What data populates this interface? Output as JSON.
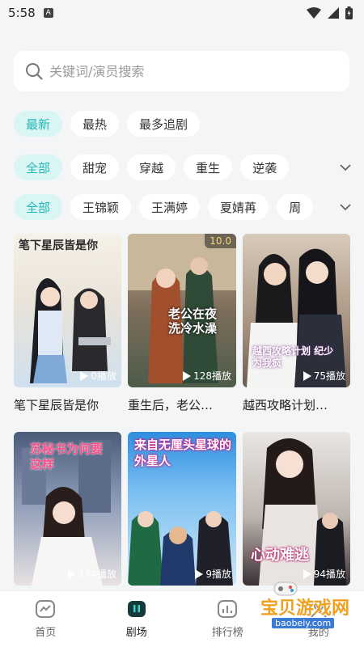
{
  "status": {
    "time": "5:58",
    "badge": "A"
  },
  "search": {
    "placeholder": "关键词/演员搜索"
  },
  "sort_tabs": [
    "最新",
    "最热",
    "最多追剧"
  ],
  "genre_tabs": [
    "全部",
    "甜宠",
    "穿越",
    "重生",
    "逆袭"
  ],
  "actor_tabs": [
    "全部",
    "王锦颖",
    "王满婷",
    "夏婧苒",
    "周"
  ],
  "dramas": [
    {
      "title": "笔下星辰皆是你",
      "plays": "0播放",
      "poster_text": "笔下星辰皆是你"
    },
    {
      "title": "重生后，老公…",
      "plays": "128播放",
      "score": "10.0",
      "poster_text": "老公在夜洗冷水澡"
    },
    {
      "title": "越西攻略计划…",
      "plays": "75播放",
      "poster_text": "越西攻略计划 纪少为我疯"
    },
    {
      "title": "",
      "plays": "174播放",
      "poster_text": "苏秘书为何要这样"
    },
    {
      "title": "",
      "plays": "9播放",
      "poster_text": "来自无厘头星球的外星人"
    },
    {
      "title": "",
      "plays": "94播放",
      "poster_text": "心动难逃"
    }
  ],
  "tabbar": [
    {
      "label": "首页",
      "icon": "home-icon"
    },
    {
      "label": "剧场",
      "icon": "theater-icon"
    },
    {
      "label": "排行榜",
      "icon": "rank-icon"
    },
    {
      "label": "我的",
      "icon": "profile-icon"
    }
  ],
  "watermark": {
    "text": "宝贝游戏网",
    "url": "baobeiy.com"
  },
  "colors": {
    "accent": "#1fb8b4",
    "accent_bg": "#d9f5f4",
    "background": "#f4f5f7"
  }
}
